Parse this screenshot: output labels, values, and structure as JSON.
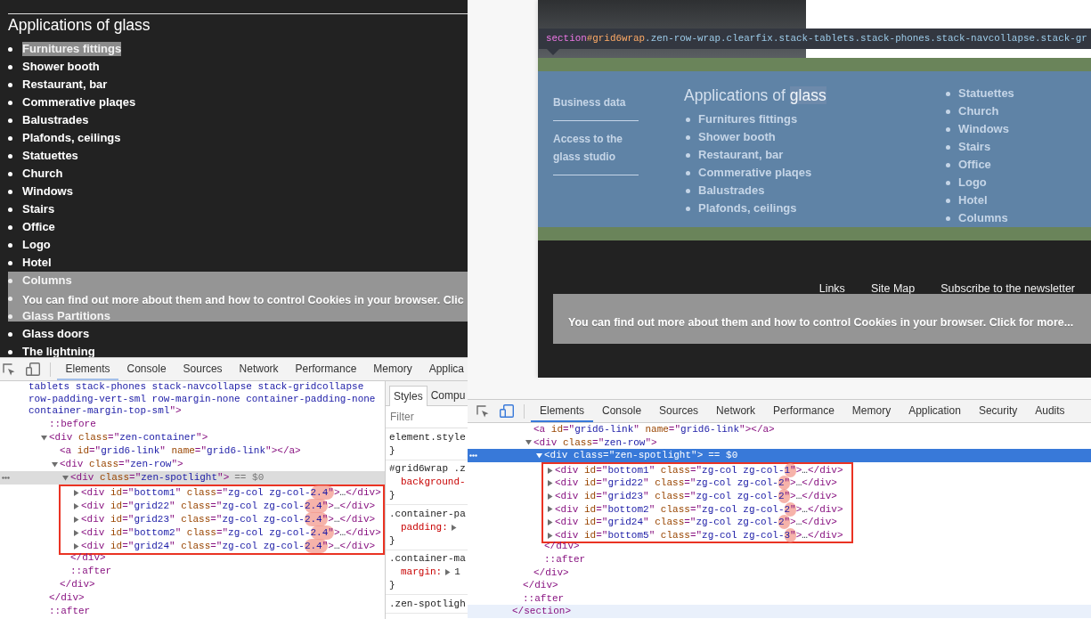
{
  "left": {
    "page": {
      "heading": "Applications of glass",
      "items": [
        {
          "kind": "entry",
          "label": "Furnitures fittings",
          "highlighted": true
        },
        {
          "kind": "entry",
          "label": "Shower booth",
          "highlighted": false
        },
        {
          "kind": "entry",
          "label": "Restaurant, bar",
          "highlighted": false
        },
        {
          "kind": "entry",
          "label": "Commerative plaqes",
          "highlighted": false
        },
        {
          "kind": "entry",
          "label": "Balustrades",
          "highlighted": false
        },
        {
          "kind": "entry",
          "label": "Plafonds, ceilings",
          "highlighted": false
        },
        {
          "kind": "entry",
          "label": "Statuettes",
          "highlighted": false
        },
        {
          "kind": "entry",
          "label": "Church",
          "highlighted": false
        },
        {
          "kind": "entry",
          "label": "Windows",
          "highlighted": false
        },
        {
          "kind": "entry",
          "label": "Stairs",
          "highlighted": false
        },
        {
          "kind": "entry",
          "label": "Office",
          "highlighted": false
        },
        {
          "kind": "entry",
          "label": "Logo",
          "highlighted": false
        },
        {
          "kind": "entry",
          "label": "Hotel",
          "highlighted": false
        },
        {
          "kind": "covered",
          "label": "Columns",
          "highlighted": false
        },
        {
          "kind": "bullet"
        },
        {
          "kind": "covered",
          "label": "Glass Partitions",
          "highlighted": false
        },
        {
          "kind": "entry",
          "label": "Glass doors",
          "highlighted": false
        },
        {
          "kind": "entry",
          "label": "The lightning",
          "highlighted": false
        }
      ],
      "cookie_banner": {
        "text": "You can find out more about them and how to control Cookies in your browser. Clic"
      }
    },
    "devtools": {
      "focused": false,
      "device_mode": false,
      "tabs": [
        {
          "label": "Elements",
          "selected": true
        },
        {
          "label": "Console",
          "selected": false
        },
        {
          "label": "Sources",
          "selected": false
        },
        {
          "label": "Network",
          "selected": false
        },
        {
          "label": "Performance",
          "selected": false
        },
        {
          "label": "Memory",
          "selected": false
        },
        {
          "label": "Applica",
          "selected": false
        }
      ],
      "tree": [
        {
          "kind": "tail",
          "text": "tablets stack-phones stack-navcollapse stack-gridcollapse row-padding-vert-sml row-margin-none container-padding-none container-margin-top-sml\">",
          "selected": false,
          "hovered": false,
          "children": [
            {
              "kind": "pseudo",
              "text": "::before",
              "selected": false
            },
            {
              "kind": "tag",
              "text": "<div class=\"zen-container\">",
              "expanded": true,
              "selected": false,
              "closing": "</div>",
              "children": [
                {
                  "kind": "tag",
                  "text": "<a id=\"grid6-link\" name=\"grid6-link\"></a>",
                  "selected": false
                },
                {
                  "kind": "tag",
                  "text": "<div class=\"zen-row\">",
                  "expanded": true,
                  "selected": false,
                  "closing": "</div>",
                  "children": [
                    {
                      "kind": "tag",
                      "text": "<div class=\"zen-spotlight\">",
                      "suffix": "== $0",
                      "expanded": true,
                      "selected": true,
                      "framed": true,
                      "closing": "</div>",
                      "children": [
                        {
                          "kind": "tag",
                          "text": "<div id=\"bottom1\" class=\"zg-col zg-col-2.4\">…</div>",
                          "expanded": false,
                          "selected": false,
                          "annotated": true
                        },
                        {
                          "kind": "tag",
                          "text": "<div id=\"grid22\" class=\"zg-col zg-col-2.4\">…</div>",
                          "expanded": false,
                          "selected": false,
                          "annotated": true
                        },
                        {
                          "kind": "tag",
                          "text": "<div id=\"grid23\" class=\"zg-col zg-col-2.4\">…</div>",
                          "expanded": false,
                          "selected": false,
                          "annotated": true
                        },
                        {
                          "kind": "tag",
                          "text": "<div id=\"bottom2\" class=\"zg-col zg-col-2.4\">…</div>",
                          "expanded": false,
                          "selected": false,
                          "annotated": true
                        },
                        {
                          "kind": "tag",
                          "text": "<div id=\"grid24\" class=\"zg-col zg-col-2.4\">…</div>",
                          "expanded": false,
                          "selected": false,
                          "annotated": true
                        }
                      ]
                    },
                    {
                      "kind": "pseudo",
                      "text": "::after",
                      "selected": false
                    }
                  ]
                }
              ]
            },
            {
              "kind": "pseudo",
              "text": "::after",
              "selected": false
            }
          ]
        }
      ],
      "styles": {
        "tabs": [
          {
            "label": "Styles",
            "selected": true
          },
          {
            "label": "Compu",
            "selected": false
          }
        ],
        "filter": {
          "placeholder": "Filter"
        },
        "rules": [
          {
            "selector": "element.style",
            "close": "}"
          },
          {
            "selector": "#grid6wrap .z",
            "declarations": [
              {
                "property": "background-"
              }
            ],
            "close": "}"
          },
          {
            "selector": ".container-pa",
            "declarations": [
              {
                "property": "padding:",
                "expandable": true
              }
            ],
            "close": "}"
          },
          {
            "selector": ".container-ma",
            "declarations": [
              {
                "property": "margin:",
                "expandable": true,
                "value": "1"
              }
            ],
            "close": "}"
          },
          {
            "selector": ".zen-spotligh"
          }
        ]
      }
    }
  },
  "right": {
    "page": {
      "inspector_tooltip": {
        "tag": "section",
        "id": "#grid6wrap",
        "classes": ".zen-row-wrap.clearfix.stack-tablets.stack-phones.stack-navcollapse.stack-gr"
      },
      "spotlight": {
        "links": [
          "Business data",
          "Access to the glass studio"
        ],
        "heading": [
          {
            "text": "Applications of",
            "highlighted": false
          },
          {
            "text": "glass",
            "highlighted": true
          }
        ],
        "columns": [
          {
            "items": [
              "Furnitures fittings",
              "Shower booth",
              "Restaurant, bar",
              "Commerative plaqes",
              "Balustrades",
              "Plafonds, ceilings"
            ]
          },
          {
            "items": [
              "Statuettes",
              "Church",
              "Windows",
              "Stairs",
              "Office",
              "Logo",
              "Hotel",
              "Columns"
            ]
          }
        ]
      },
      "footer_links": [
        "Links",
        "Site Map",
        "Subscribe to the newsletter"
      ],
      "cookie_banner": {
        "text": "You can find out more about them and how to control Cookies in your browser. Click for more..."
      }
    },
    "devtools": {
      "focused": true,
      "device_mode": true,
      "tabs": [
        {
          "label": "Elements",
          "selected": true
        },
        {
          "label": "Console",
          "selected": false
        },
        {
          "label": "Sources",
          "selected": false
        },
        {
          "label": "Network",
          "selected": false
        },
        {
          "label": "Performance",
          "selected": false
        },
        {
          "label": "Memory",
          "selected": false
        },
        {
          "label": "Application",
          "selected": false
        },
        {
          "label": "Security",
          "selected": false
        },
        {
          "label": "Audits",
          "selected": false
        }
      ],
      "tree": [
        {
          "kind": "tag",
          "selected": false,
          "hovered": true,
          "closing": "</section>",
          "children": [
            {
              "kind": "tag",
              "selected": false,
              "closing": "</div>",
              "children": [
                {
                  "kind": "tag",
                  "text": "<a id=\"grid6-link\" name=\"grid6-link\"></a>",
                  "selected": false
                },
                {
                  "kind": "tag",
                  "text": "<div class=\"zen-row\">",
                  "expanded": true,
                  "selected": false,
                  "closing": "</div>",
                  "children": [
                    {
                      "kind": "tag",
                      "text": "<div class=\"zen-spotlight\">",
                      "suffix": "== $0",
                      "expanded": true,
                      "selected": true,
                      "framed": true,
                      "closing": "</div>",
                      "children": [
                        {
                          "kind": "tag",
                          "text": "<div id=\"bottom1\" class=\"zg-col zg-col-1\">…</div>",
                          "expanded": false,
                          "selected": false,
                          "annotated": true
                        },
                        {
                          "kind": "tag",
                          "text": "<div id=\"grid22\" class=\"zg-col zg-col-2\">…</div>",
                          "expanded": false,
                          "selected": false,
                          "annotated": true
                        },
                        {
                          "kind": "tag",
                          "text": "<div id=\"grid23\" class=\"zg-col zg-col-2\">…</div>",
                          "expanded": false,
                          "selected": false,
                          "annotated": true
                        },
                        {
                          "kind": "tag",
                          "text": "<div id=\"bottom2\" class=\"zg-col zg-col-2\">…</div>",
                          "expanded": false,
                          "selected": false,
                          "annotated": true
                        },
                        {
                          "kind": "tag",
                          "text": "<div id=\"grid24\" class=\"zg-col zg-col-2\">…</div>",
                          "expanded": false,
                          "selected": false,
                          "annotated": true
                        },
                        {
                          "kind": "tag",
                          "text": "<div id=\"bottom5\" class=\"zg-col zg-col-3\">…</div>",
                          "expanded": false,
                          "selected": false,
                          "annotated": true
                        }
                      ]
                    },
                    {
                      "kind": "pseudo",
                      "text": "::after",
                      "selected": false
                    }
                  ]
                }
              ]
            },
            {
              "kind": "pseudo",
              "text": "::after",
              "selected": false
            }
          ]
        }
      ]
    }
  }
}
